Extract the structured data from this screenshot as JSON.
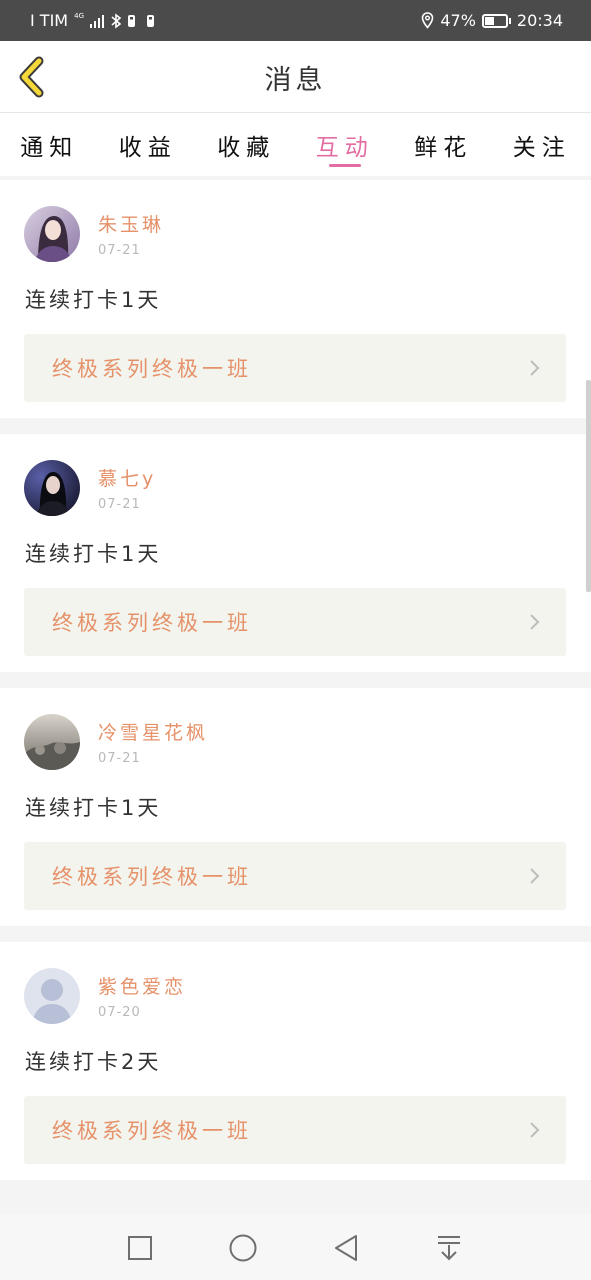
{
  "status_bar": {
    "carrier": "I TIM",
    "network": "4G",
    "battery_percent": "47%",
    "battery_level": 0.47,
    "time": "20:34",
    "icons": [
      "signal-icon",
      "bluetooth-icon",
      "vibrate-icon",
      "battery-saver-icon",
      "location-icon",
      "battery-icon"
    ]
  },
  "header": {
    "title": "消息",
    "back_icon": "chevron-left-icon"
  },
  "tabs": [
    {
      "label": "通知",
      "active": false
    },
    {
      "label": "收益",
      "active": false
    },
    {
      "label": "收藏",
      "active": false
    },
    {
      "label": "互动",
      "active": true
    },
    {
      "label": "鲜花",
      "active": false
    },
    {
      "label": "关注",
      "active": false
    }
  ],
  "feed": [
    {
      "username": "朱玉琳",
      "date": "07-21",
      "message": "连续打卡1天",
      "class_name": "终极系列终极一班",
      "avatar": "user-photo-avatar"
    },
    {
      "username": "慕七y",
      "date": "07-21",
      "message": "连续打卡1天",
      "class_name": "终极系列终极一班",
      "avatar": "user-photo-avatar"
    },
    {
      "username": "冷雪星花枫",
      "date": "07-21",
      "message": "连续打卡1天",
      "class_name": "终极系列终极一班",
      "avatar": "user-photo-avatar"
    },
    {
      "username": "紫色爱恋",
      "date": "07-20",
      "message": "连续打卡2天",
      "class_name": "终极系列终极一班",
      "avatar": "default-user-avatar"
    }
  ],
  "nav_bar": {
    "icons": [
      "recent-apps-icon",
      "home-icon",
      "back-icon",
      "notification-pulldown-icon"
    ]
  },
  "colors": {
    "accent_pink": "#e36da2",
    "username_orange": "#e5926a",
    "back_arrow_yellow": "#f5d83a",
    "status_bar_bg": "#4b4b4b",
    "class_link_bg": "#f4f4ee"
  }
}
